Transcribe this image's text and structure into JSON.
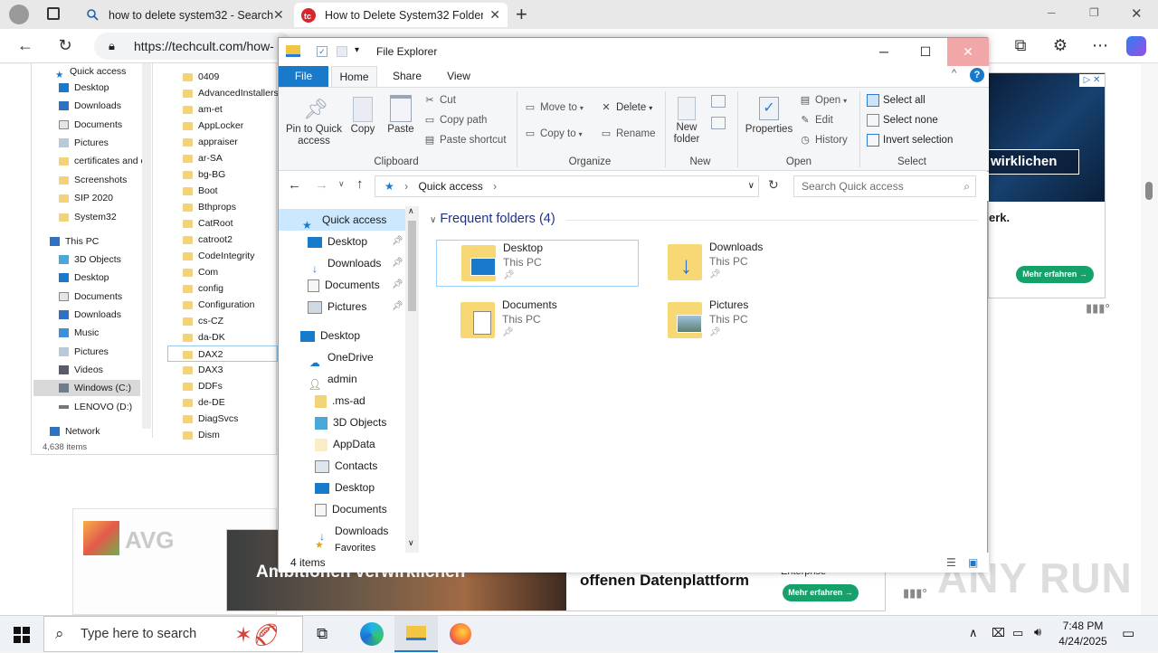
{
  "browser": {
    "tabs": [
      {
        "title": "how to delete system32 - Search",
        "active": false
      },
      {
        "title": "How to Delete System32 Folder in",
        "active": true
      }
    ],
    "new_tab": "+",
    "url": "https://techcult.com/how-",
    "window_controls": {
      "minimize": "─",
      "restore": "❐",
      "close": "✕"
    }
  },
  "background_explorer": {
    "quick_access": "Quick access",
    "quick_items": [
      "Desktop",
      "Downloads",
      "Documents",
      "Pictures",
      "certificates and c",
      "Screenshots",
      "SIP 2020",
      "System32"
    ],
    "this_pc": "This PC",
    "pc_items": [
      "3D Objects",
      "Desktop",
      "Documents",
      "Downloads",
      "Music",
      "Pictures",
      "Videos",
      "Windows (C:)",
      "LENOVO (D:)"
    ],
    "network": "Network",
    "count": "4,638 items",
    "folders": [
      "0409",
      "AdvancedInstallers",
      "am-et",
      "AppLocker",
      "appraiser",
      "ar-SA",
      "bg-BG",
      "Boot",
      "Bthprops",
      "CatRoot",
      "catroot2",
      "CodeIntegrity",
      "Com",
      "config",
      "Configuration",
      "cs-CZ",
      "da-DK",
      "DAX2",
      "DAX3",
      "DDFs",
      "de-DE",
      "DiagSvcs",
      "Dism"
    ]
  },
  "ads": {
    "right_heading": "wirklichen",
    "right_text": "erk.",
    "button": "Mehr erfahren →",
    "bottom_left": "Ambitionen verwirklichen",
    "bottom_mid": "offenen Datenplattform",
    "bottom_small": "Enterprise",
    "avg": "AVG",
    "watermark": "ANY RUN"
  },
  "explorer": {
    "title": "File Explorer",
    "tabs": [
      "File",
      "Home",
      "Share",
      "View"
    ],
    "clipboard": {
      "pin": "Pin to Quick access",
      "copy": "Copy",
      "paste": "Paste",
      "cut": "Cut",
      "copy_path": "Copy path",
      "paste_shortcut": "Paste shortcut",
      "label": "Clipboard"
    },
    "organize": {
      "move_to": "Move to",
      "copy_to": "Copy to",
      "delete": "Delete",
      "rename": "Rename",
      "label": "Organize"
    },
    "new": {
      "new_folder": "New folder",
      "label": "New"
    },
    "open": {
      "properties": "Properties",
      "open": "Open",
      "edit": "Edit",
      "history": "History",
      "label": "Open"
    },
    "select": {
      "all": "Select all",
      "none": "Select none",
      "invert": "Invert selection",
      "label": "Select"
    },
    "breadcrumb": "Quick access",
    "search_placeholder": "Search Quick access",
    "nav": [
      {
        "label": "Quick access",
        "icon": "star-icon",
        "pinned": false
      },
      {
        "label": "Desktop",
        "icon": "desktop-icon",
        "pinned": true
      },
      {
        "label": "Downloads",
        "icon": "download-arrow-icon",
        "pinned": true
      },
      {
        "label": "Documents",
        "icon": "document-icon",
        "pinned": true
      },
      {
        "label": "Pictures",
        "icon": "picture-icon",
        "pinned": true
      },
      {
        "label": "Desktop",
        "icon": "desktop-icon",
        "pinned": false
      },
      {
        "label": "OneDrive",
        "icon": "cloud-icon",
        "pinned": false
      },
      {
        "label": "admin",
        "icon": "user-icon",
        "pinned": false
      },
      {
        "label": ".ms-ad",
        "icon": "folder-icon",
        "pinned": false
      },
      {
        "label": "3D Objects",
        "icon": "cube-icon",
        "pinned": false
      },
      {
        "label": "AppData",
        "icon": "folder-icon",
        "pinned": false
      },
      {
        "label": "Contacts",
        "icon": "contacts-icon",
        "pinned": false
      },
      {
        "label": "Desktop",
        "icon": "folder-icon",
        "pinned": false
      },
      {
        "label": "Documents",
        "icon": "document-icon",
        "pinned": false
      },
      {
        "label": "Downloads",
        "icon": "download-arrow-icon",
        "pinned": false
      },
      {
        "label": "Favorites",
        "icon": "star-icon",
        "pinned": false
      }
    ],
    "section_title": "Frequent folders (4)",
    "folders": [
      {
        "name": "Desktop",
        "location": "This PC"
      },
      {
        "name": "Downloads",
        "location": "This PC"
      },
      {
        "name": "Documents",
        "location": "This PC"
      },
      {
        "name": "Pictures",
        "location": "This PC"
      }
    ],
    "status": "4 items"
  },
  "taskbar": {
    "search_placeholder": "Type here to search",
    "time": "7:48 PM",
    "date": "4/24/2025"
  },
  "colors": {
    "accent": "#1979ca",
    "selection": "#cce8ff",
    "close_hover": "#e81123"
  }
}
